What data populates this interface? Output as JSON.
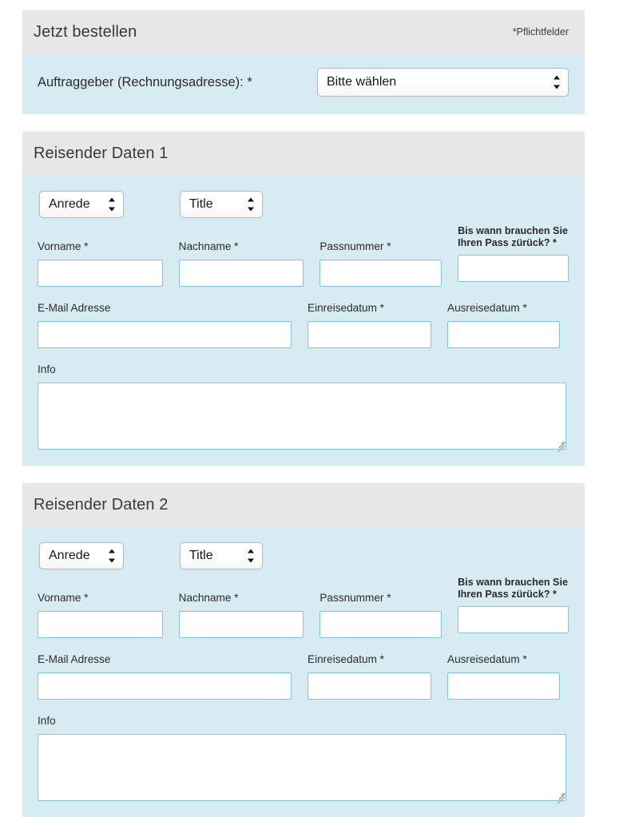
{
  "order_panel": {
    "title": "Jetzt bestellen",
    "required_note": "*Pflichtfelder",
    "client_label": "Auftraggeber (Rechnungsadresse): *",
    "client_select_value": "Bitte wählen"
  },
  "travellers": [
    {
      "title": "Reisender Daten 1",
      "salutation_select_value": "Anrede",
      "title_select_value": "Title",
      "labels": {
        "first_name": "Vorname *",
        "last_name": "Nachname *",
        "passport_number": "Passnummer *",
        "passport_return": "Bis wann brauchen Sie Ihren Pass zürück? *",
        "email": "E-Mail Adresse",
        "entry_date": "Einreisedatum *",
        "exit_date": "Ausreisedatum *",
        "info": "Info"
      },
      "values": {
        "first_name": "",
        "last_name": "",
        "passport_number": "",
        "passport_return": "",
        "email": "",
        "entry_date": "",
        "exit_date": "",
        "info": ""
      }
    },
    {
      "title": "Reisender Daten 2",
      "salutation_select_value": "Anrede",
      "title_select_value": "Title",
      "labels": {
        "first_name": "Vorname *",
        "last_name": "Nachname *",
        "passport_number": "Passnummer *",
        "passport_return": "Bis wann brauchen Sie Ihren Pass zürück? *",
        "email": "E-Mail Adresse",
        "entry_date": "Einreisedatum *",
        "exit_date": "Ausreisedatum *",
        "info": "Info"
      },
      "values": {
        "first_name": "",
        "last_name": "",
        "passport_number": "",
        "passport_return": "",
        "email": "",
        "entry_date": "",
        "exit_date": "",
        "info": ""
      }
    }
  ],
  "icons": {
    "select_arrows": "chevron-up-down-icon",
    "textarea_resize": "resize-handle-icon"
  },
  "colors": {
    "panel_body": "#d7ebf3",
    "panel_header": "#e8e7e6",
    "input_border": "#7dc5e0",
    "page_background": "#ffffff",
    "text": "#2b2b2b"
  }
}
